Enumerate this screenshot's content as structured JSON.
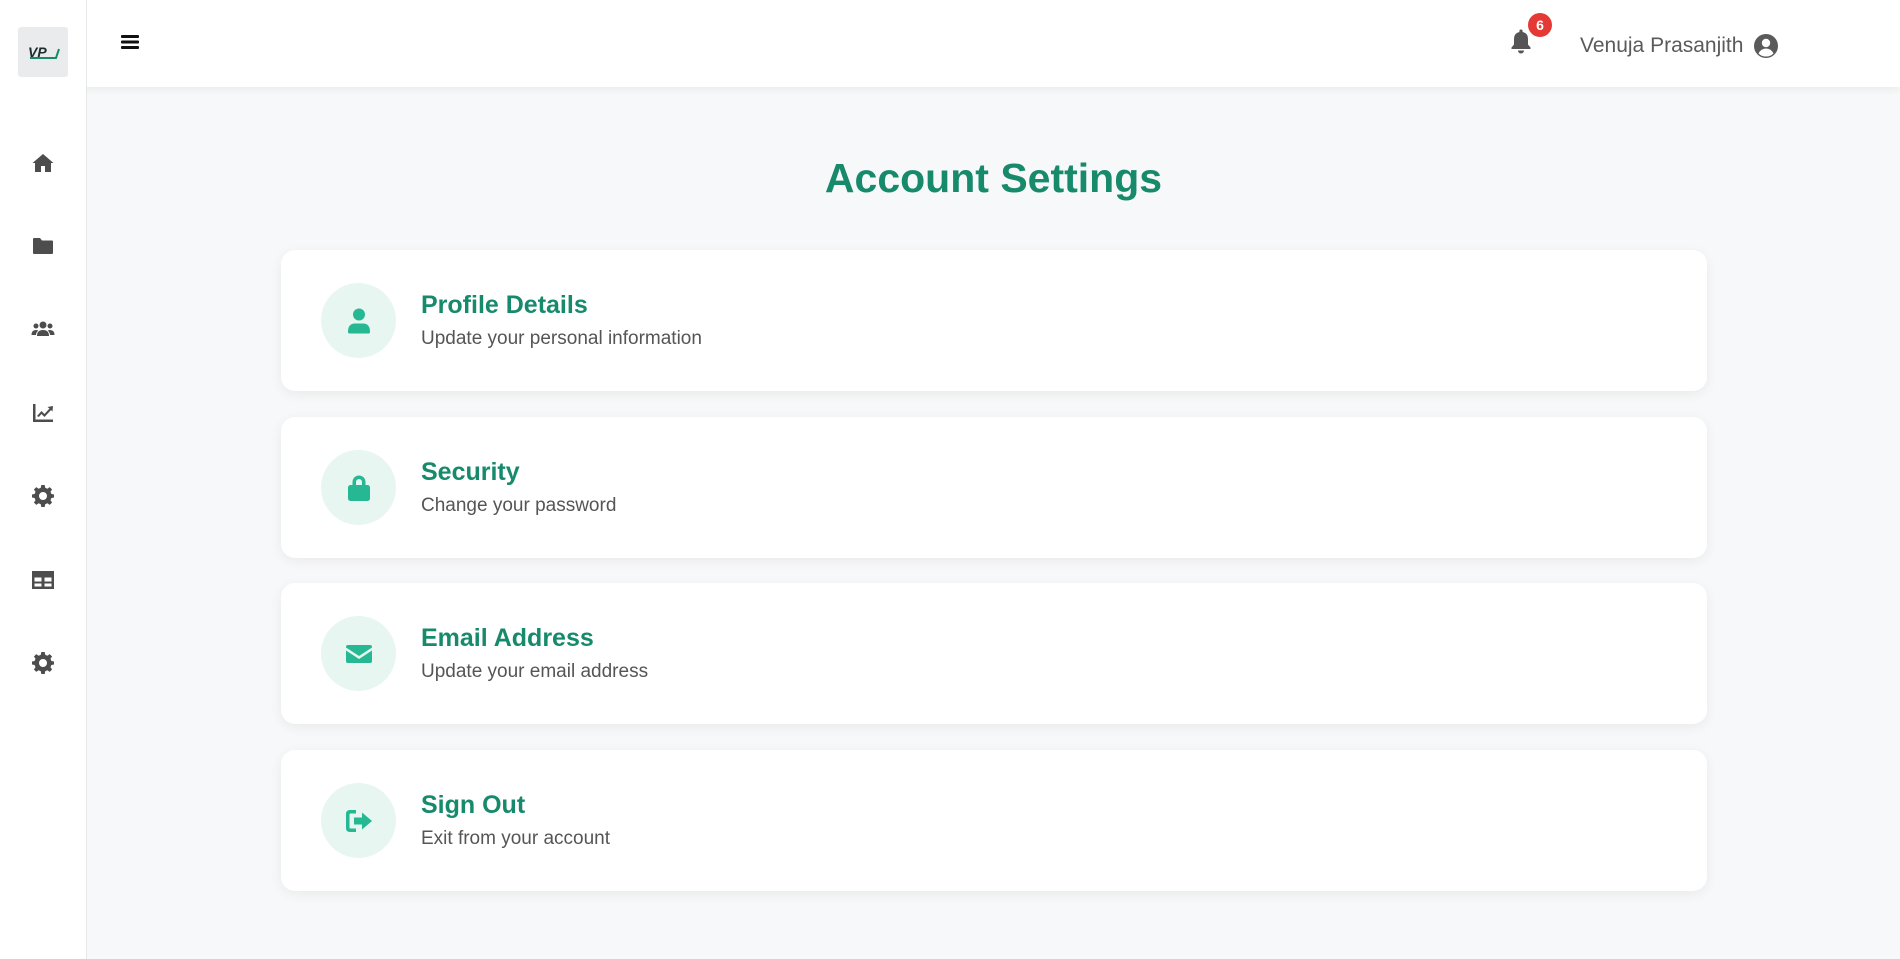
{
  "app": {
    "logo_text": "VP"
  },
  "sidebar": {
    "items": [
      {
        "name": "home",
        "icon": "home-icon"
      },
      {
        "name": "folders",
        "icon": "folder-icon"
      },
      {
        "name": "users",
        "icon": "users-icon"
      },
      {
        "name": "analytics",
        "icon": "chart-line-icon"
      },
      {
        "name": "settings",
        "icon": "gear-icon"
      },
      {
        "name": "table",
        "icon": "table-icon"
      },
      {
        "name": "settings-2",
        "icon": "gear-icon"
      }
    ]
  },
  "topbar": {
    "notification_count": "6",
    "user_name": "Venuja Prasanjith"
  },
  "page": {
    "title": "Account Settings"
  },
  "cards": [
    {
      "title": "Profile Details",
      "description": "Update your personal information",
      "icon": "user-icon"
    },
    {
      "title": "Security",
      "description": "Change your password",
      "icon": "lock-icon"
    },
    {
      "title": "Email Address",
      "description": "Update your email address",
      "icon": "envelope-icon"
    },
    {
      "title": "Sign Out",
      "description": "Exit from your account",
      "icon": "sign-out-icon"
    }
  ],
  "colors": {
    "accent": "#178a6c",
    "icon_accent": "#25b892",
    "icon_bg": "#e8f6f2",
    "badge": "#e53935"
  }
}
